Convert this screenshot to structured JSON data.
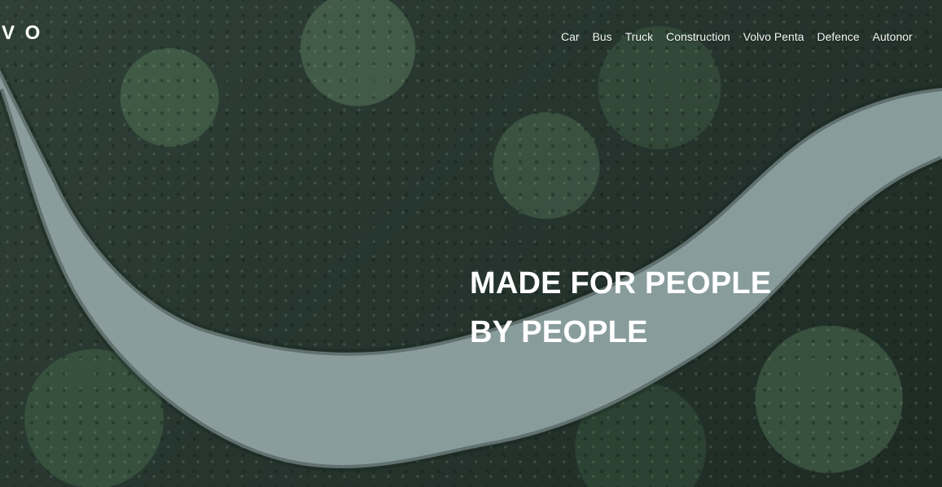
{
  "header": {
    "logo_text": "V O",
    "nav": [
      {
        "label": "Car"
      },
      {
        "label": "Bus"
      },
      {
        "label": "Truck"
      },
      {
        "label": "Construction"
      },
      {
        "label": "Volvo Penta"
      },
      {
        "label": "Defence"
      },
      {
        "label": "Autonor"
      }
    ]
  },
  "hero": {
    "headline_line1": "MADE FOR PEOPLE",
    "headline_line2": "BY PEOPLE"
  }
}
